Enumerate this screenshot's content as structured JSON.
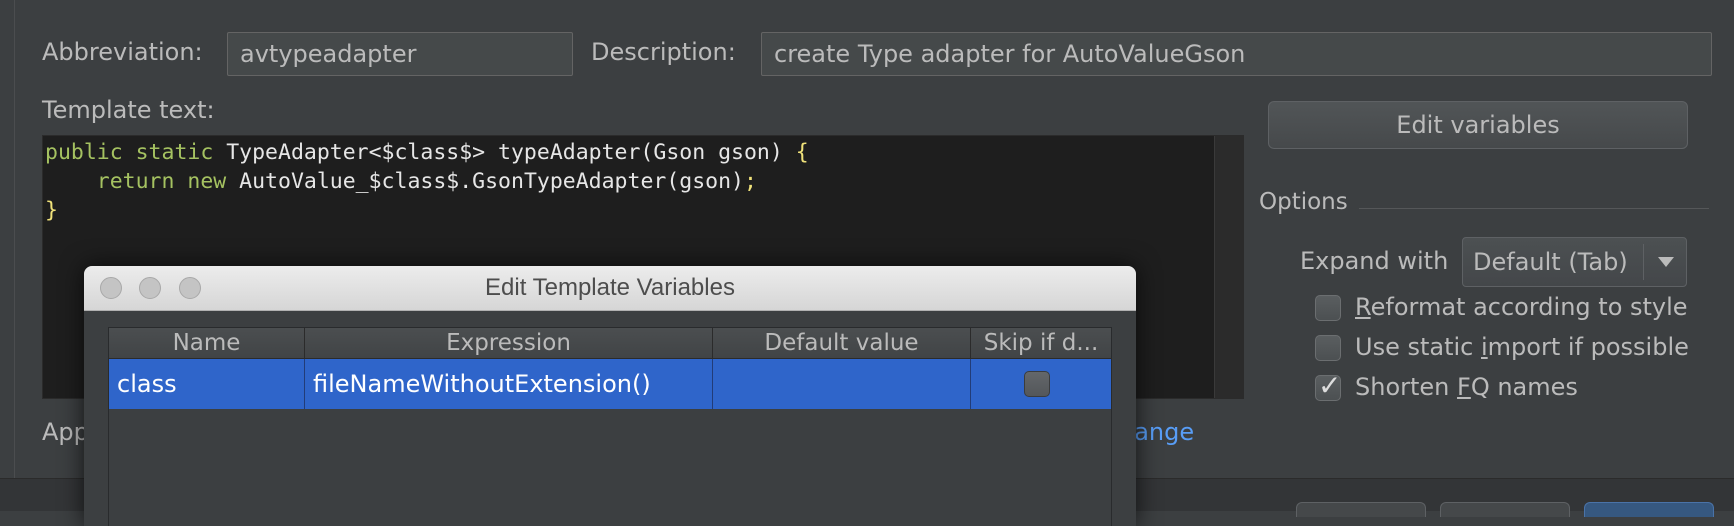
{
  "form": {
    "abbreviation_label": "Abbreviation:",
    "abbreviation_value": "avtypeadapter",
    "description_label": "Description:",
    "description_value": "create Type adapter for AutoValueGson",
    "template_text_label": "Template text:",
    "code_lines": [
      [
        {
          "t": "public static ",
          "c": "kw"
        },
        {
          "t": "TypeAdapter<$class$> typeAdapter(Gson gson) ",
          "c": "tx"
        },
        {
          "t": "{",
          "c": "br"
        }
      ],
      [
        {
          "t": "    return new ",
          "c": "kw"
        },
        {
          "t": "AutoValue_$class$.GsonTypeAdapter(gson)",
          "c": "tx"
        },
        {
          "t": ";",
          "c": "br"
        }
      ],
      [
        {
          "t": "}",
          "c": "br"
        }
      ]
    ],
    "applicable_label": "App",
    "change_link": "hange"
  },
  "sidebar": {
    "edit_variables_button": "Edit variables",
    "options_title": "Options",
    "expand_with_label": "Expand with",
    "expand_with_value": "Default (Tab)",
    "checkboxes": [
      {
        "pre": "",
        "u": "R",
        "post": "eformat according to style",
        "checked": false
      },
      {
        "pre": "Use static ",
        "u": "i",
        "post": "mport if possible",
        "checked": false
      },
      {
        "pre": "Shorten ",
        "u": "F",
        "post": "Q names",
        "checked": true
      }
    ]
  },
  "dialog": {
    "title": "Edit Template Variables",
    "columns": [
      "Name",
      "Expression",
      "Default value",
      "Skip if d..."
    ],
    "rows": [
      {
        "name": "class",
        "expression": "fileNameWithoutExtension()",
        "default_value": "",
        "skip_if_defined": false
      }
    ]
  },
  "colors": {
    "background": "#3c3f41",
    "selection": "#2f65ca",
    "keyword": "#a5c261",
    "link": "#589df6"
  }
}
